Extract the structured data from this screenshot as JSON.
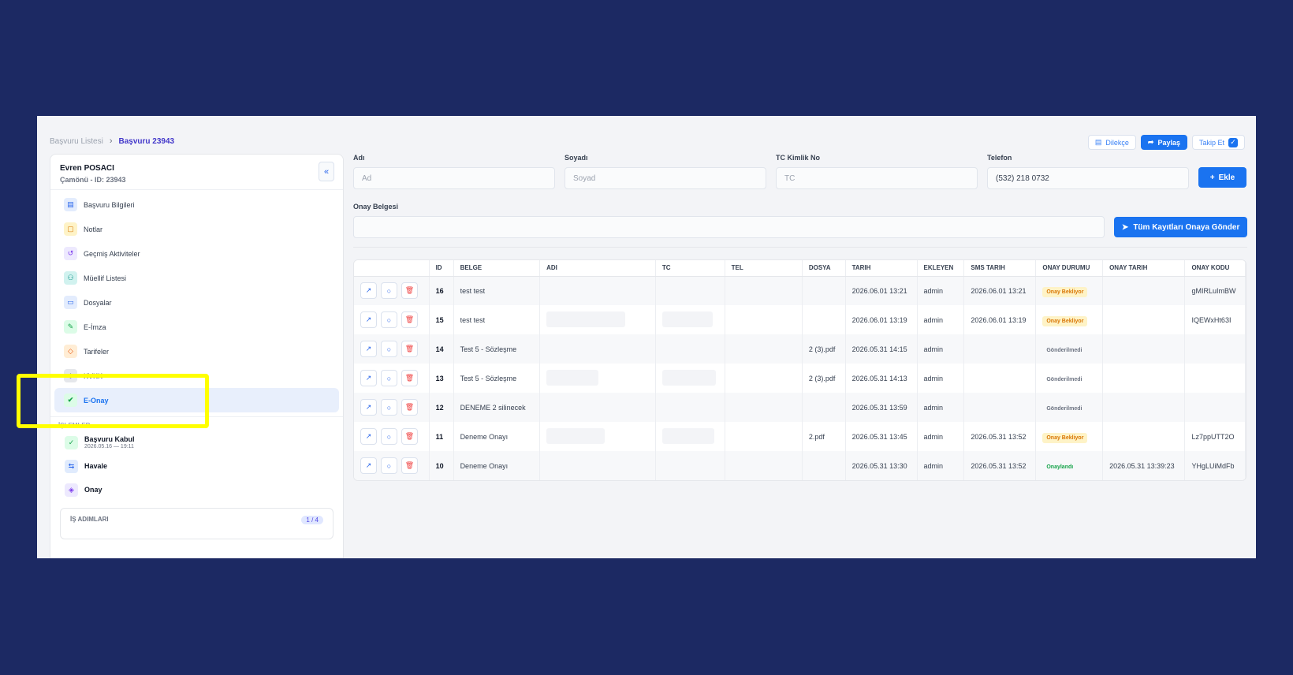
{
  "breadcrumb": {
    "parent": "Başvuru Listesi",
    "current": "Başvuru 23943"
  },
  "top_actions": {
    "petition": "Dilekçe",
    "share": "Paylaş",
    "follow": "Takip Et"
  },
  "profile": {
    "name": "Evren POSACI",
    "meta": "Çamönü -   ID: 23943"
  },
  "nav": [
    {
      "label": "Başvuru Bilgileri",
      "icon": "document-icon",
      "color": "blue"
    },
    {
      "label": "Notlar",
      "icon": "note-icon",
      "color": "yellow"
    },
    {
      "label": "Geçmiş Aktiviteler",
      "icon": "history-icon",
      "color": "purple"
    },
    {
      "label": "Müellif Listesi",
      "icon": "users-icon",
      "color": "teal"
    },
    {
      "label": "Dosyalar",
      "icon": "folder-icon",
      "color": "blue"
    },
    {
      "label": "E-İmza",
      "icon": "pen-icon",
      "color": "green"
    },
    {
      "label": "Tarifeler",
      "icon": "tag-icon",
      "color": "orange"
    },
    {
      "label": "KVKK",
      "icon": "shield-icon",
      "color": "gray"
    },
    {
      "label": "E-Onay",
      "icon": "check-circle-icon",
      "color": "green",
      "active": true
    }
  ],
  "operations": {
    "title": "İŞLEMLER",
    "items": [
      {
        "title": "Başvuru Kabul",
        "sub": "2026.05.16 — 19:11",
        "icon": "check-icon"
      },
      {
        "title": "Havale",
        "sub": "",
        "icon": "transfer-icon"
      },
      {
        "title": "Onay",
        "sub": "",
        "icon": "shield-check-icon"
      }
    ]
  },
  "steps": {
    "label": "İŞ ADIMLARI",
    "count": "1 / 4"
  },
  "form": {
    "ad_label": "Adı",
    "ad_placeholder": "Ad",
    "soyad_label": "Soyadı",
    "soyad_placeholder": "Soyad",
    "tc_label": "TC Kimlik No",
    "tc_placeholder": "TC",
    "tel_label": "Telefon",
    "tel_value": "(532) 218 0732",
    "add_button": "Ekle",
    "belge_label": "Onay Belgesi",
    "send_all_button": "Tüm Kayıtları Onaya Gönder"
  },
  "table": {
    "columns": [
      "",
      "ID",
      "BELGE",
      "ADI",
      "TC",
      "TEL",
      "DOSYA",
      "TARIH",
      "EKLEYEN",
      "SMS TARIH",
      "ONAY DURUMU",
      "ONAY TARIH",
      "ONAY KODU"
    ],
    "rows": [
      {
        "id": "16",
        "belge": "test test",
        "adi": "",
        "tc": "",
        "tel": "",
        "dosya": "",
        "tarih": "2026.06.01 13:21",
        "ekleyen": "admin",
        "sms": "2026.06.01 13:21",
        "durum": "Onay Bekliyor",
        "durum_type": "pending",
        "onay_tarih": "",
        "kod": "gMIRLuImBW"
      },
      {
        "id": "15",
        "belge": "test test",
        "adi": "",
        "tc": "",
        "tel": "",
        "dosya": "",
        "tarih": "2026.06.01 13:19",
        "ekleyen": "admin",
        "sms": "2026.06.01 13:19",
        "durum": "Onay Bekliyor",
        "durum_type": "pending",
        "onay_tarih": "",
        "kod": "IQEWxHt63I"
      },
      {
        "id": "14",
        "belge": "Test 5 - Sözleşme",
        "adi": "",
        "tc": "",
        "tel": "",
        "dosya": "2 (3).pdf",
        "tarih": "2026.05.31 14:15",
        "ekleyen": "admin",
        "sms": "",
        "durum": "Gönderilmedi",
        "durum_type": "notsent",
        "onay_tarih": "",
        "kod": ""
      },
      {
        "id": "13",
        "belge": "Test 5 - Sözleşme",
        "adi": "",
        "tc": "",
        "tel": "",
        "dosya": "2 (3).pdf",
        "tarih": "2026.05.31 14:13",
        "ekleyen": "admin",
        "sms": "",
        "durum": "Gönderilmedi",
        "durum_type": "notsent",
        "onay_tarih": "",
        "kod": ""
      },
      {
        "id": "12",
        "belge": "DENEME 2 silinecek",
        "adi": "",
        "tc": "",
        "tel": "",
        "dosya": "",
        "tarih": "2026.05.31 13:59",
        "ekleyen": "admin",
        "sms": "",
        "durum": "Gönderilmedi",
        "durum_type": "notsent",
        "onay_tarih": "",
        "kod": ""
      },
      {
        "id": "11",
        "belge": "Deneme Onayı",
        "adi": "",
        "tc": "",
        "tel": "",
        "dosya": "2.pdf",
        "tarih": "2026.05.31 13:45",
        "ekleyen": "admin",
        "sms": "2026.05.31 13:52",
        "durum": "Onay Bekliyor",
        "durum_type": "pending",
        "onay_tarih": "",
        "kod": "Lz7ppUTT2O"
      },
      {
        "id": "10",
        "belge": "Deneme Onayı",
        "adi": "",
        "tc": "",
        "tel": "",
        "dosya": "",
        "tarih": "2026.05.31 13:30",
        "ekleyen": "admin",
        "sms": "2026.05.31 13:52",
        "durum": "Onaylandı",
        "durum_type": "ok",
        "onay_tarih": "2026.05.31 13:39:23",
        "kod": "YHgLUiMdFb"
      }
    ]
  }
}
